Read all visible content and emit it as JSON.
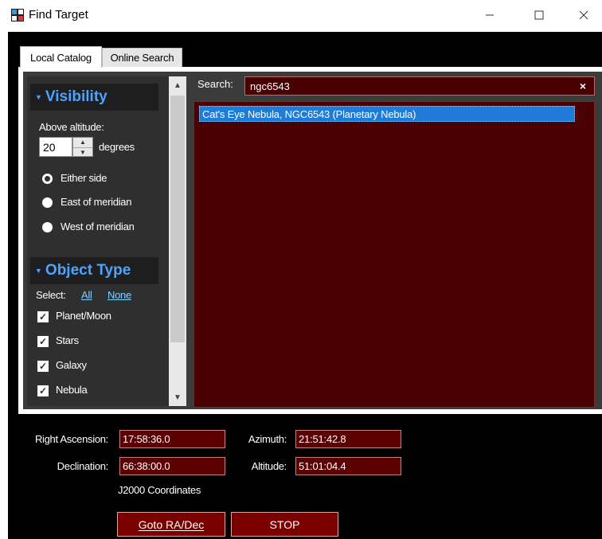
{
  "window": {
    "title": "Find Target",
    "icon": "app-target-icon",
    "controls": {
      "minimize": "—",
      "maximize": "☐",
      "close": "✕"
    }
  },
  "tabs": [
    {
      "label": "Local Catalog",
      "active": true
    },
    {
      "label": "Online Search",
      "active": false
    }
  ],
  "visibility": {
    "header": "Visibility",
    "above_altitude_label": "Above altitude:",
    "altitude_value": "20",
    "degrees_label": "degrees",
    "options": [
      {
        "label": "Either side",
        "selected": true
      },
      {
        "label": "East of meridian",
        "selected": false
      },
      {
        "label": "West of meridian",
        "selected": false
      }
    ]
  },
  "object_type": {
    "header": "Object Type",
    "select_label": "Select:",
    "all_link": "All",
    "none_link": "None",
    "items": [
      {
        "label": "Planet/Moon",
        "checked": true
      },
      {
        "label": "Stars",
        "checked": true
      },
      {
        "label": "Galaxy",
        "checked": true
      },
      {
        "label": "Nebula",
        "checked": true
      }
    ]
  },
  "search": {
    "label": "Search:",
    "value": "ngc6543",
    "clear": "×"
  },
  "results": [
    {
      "label": "Cat's Eye Nebula, NGC6543 (Planetary Nebula)",
      "selected": true
    }
  ],
  "coords": {
    "ra_label": "Right Ascension:",
    "ra_value": "17:58:36.0",
    "dec_label": "Declination:",
    "dec_value": "66:38:00.0",
    "az_label": "Azimuth:",
    "az_value": "21:51:42.8",
    "alt_label": "Altitude:",
    "alt_value": "51:01:04.4",
    "epoch_note": "J2000 Coordinates"
  },
  "buttons": {
    "goto": "Goto RA/Dec",
    "stop": "STOP"
  },
  "colors": {
    "accent_header": "#4da3ff",
    "list_background": "#4a0000",
    "selection": "#1e7bd6",
    "button_red": "#7a0000"
  }
}
